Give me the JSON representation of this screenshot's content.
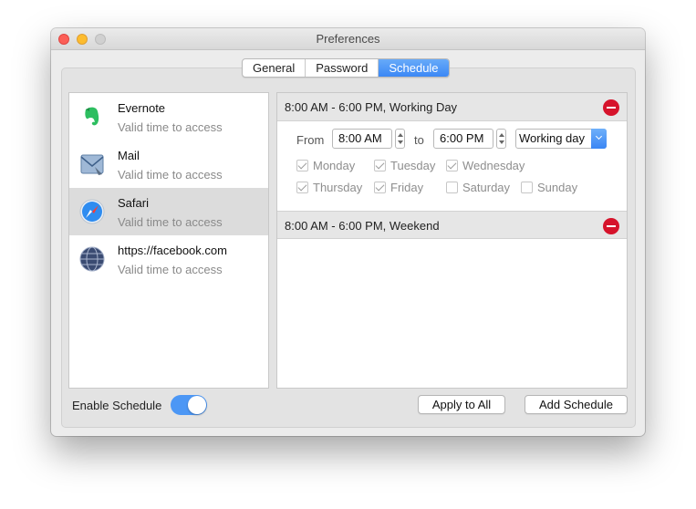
{
  "window": {
    "title": "Preferences"
  },
  "tabs": [
    {
      "label": "General",
      "active": false
    },
    {
      "label": "Password",
      "active": false
    },
    {
      "label": "Schedule",
      "active": true
    }
  ],
  "apps": [
    {
      "name": "Evernote",
      "status": "Valid time to access",
      "icon": "evernote-icon",
      "selected": false
    },
    {
      "name": "Mail",
      "status": "Valid time to access",
      "icon": "mail-icon",
      "selected": false
    },
    {
      "name": "Safari",
      "status": "Valid time to access",
      "icon": "safari-icon",
      "selected": true
    },
    {
      "name": "https://facebook.com",
      "status": "Valid time to access",
      "icon": "globe-icon",
      "selected": false
    }
  ],
  "schedules": [
    {
      "title": "8:00 AM - 6:00 PM, Working Day",
      "from_label": "From",
      "from_value": "8:00 AM",
      "to_label": "to",
      "to_value": "6:00 PM",
      "type_value": "Working day",
      "days": [
        {
          "label": "Monday",
          "checked": true
        },
        {
          "label": "Tuesday",
          "checked": true
        },
        {
          "label": "Wednesday",
          "checked": true
        },
        {
          "label": "Thursday",
          "checked": true
        },
        {
          "label": "Friday",
          "checked": true
        },
        {
          "label": "Saturday",
          "checked": false
        },
        {
          "label": "Sunday",
          "checked": false
        }
      ]
    },
    {
      "title": "8:00 AM - 6:00 PM, Weekend"
    }
  ],
  "footer": {
    "enable_label": "Enable Schedule",
    "enable_on": true,
    "apply_label": "Apply to All",
    "add_label": "Add Schedule"
  },
  "colors": {
    "accent": "#3b88f5",
    "remove": "#d6132b",
    "window_bg": "#ececec"
  }
}
